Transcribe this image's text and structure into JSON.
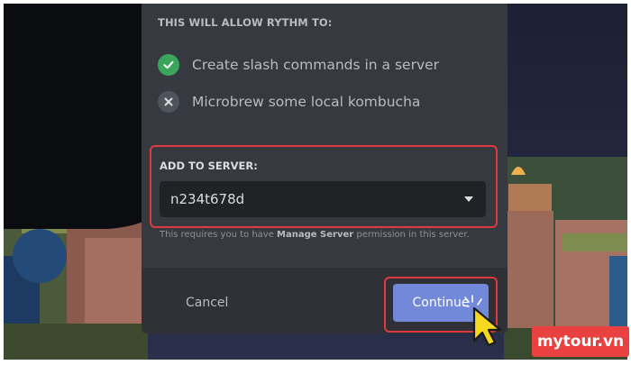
{
  "permissions": {
    "heading": "THIS WILL ALLOW RYTHM TO:",
    "items": [
      {
        "label": "Create slash commands in a server",
        "state": "allowed",
        "icon": "check-icon"
      },
      {
        "label": "Microbrew some local kombucha",
        "state": "not-allowed",
        "icon": "x-icon"
      }
    ]
  },
  "server": {
    "label": "ADD TO SERVER:",
    "selected": "n234t678d",
    "note_prefix": "This requires you to have ",
    "note_bold": "Manage Server",
    "note_suffix": " permission in this server."
  },
  "footer": {
    "cancel_label": "Cancel",
    "continue_label": "Continue"
  },
  "watermark": {
    "text": "mytour.vn"
  },
  "colors": {
    "modal": "#36393f",
    "footer": "#2f3136",
    "select": "#202225",
    "blurple": "#7289da",
    "highlight": "#e03a3e",
    "check": "#3ba55c",
    "brand": "#e8413f"
  }
}
